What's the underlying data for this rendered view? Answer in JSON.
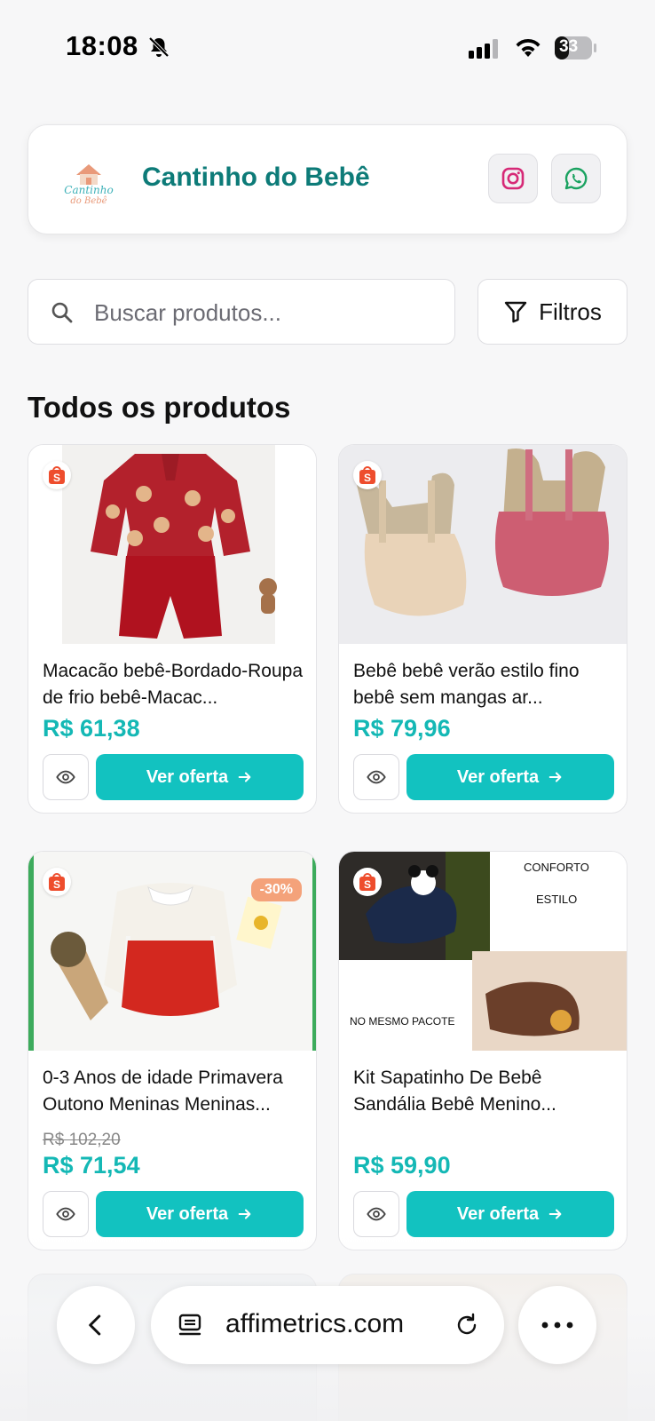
{
  "status_bar": {
    "time": "18:08",
    "battery": "33"
  },
  "header": {
    "brand_name": "Cantinho do Bebê",
    "logo_text_line1": "Cantinho",
    "logo_text_line2": "do Bebê",
    "instagram_color": "#d62976",
    "whatsapp_color": "#1aa260"
  },
  "search": {
    "placeholder": "Buscar produtos...",
    "value": ""
  },
  "filters_label": "Filtros",
  "section_title": "Todos os produtos",
  "products": [
    {
      "title": "Macacão bebê-Bordado-Roupa de frio bebê-Macac...",
      "old_price": "",
      "price": "R$ 61,38",
      "discount": "",
      "offer_label": "Ver oferta"
    },
    {
      "title": "Bebê bebê verão estilo fino bebê sem mangas ar...",
      "old_price": "",
      "price": "R$ 79,96",
      "discount": "",
      "offer_label": "Ver oferta"
    },
    {
      "title": "0-3 Anos de idade Primavera Outono Meninas Meninas...",
      "old_price": "R$ 102,20",
      "price": "R$ 71,54",
      "discount": "-30%",
      "offer_label": "Ver oferta"
    },
    {
      "title": "Kit Sapatinho De Bebê Sandália Bebê Menino...",
      "old_price": "",
      "price": "R$ 59,90",
      "discount": "",
      "offer_label": "Ver oferta",
      "image_text": {
        "top1": "CONFORTO",
        "top2": "ESTILO",
        "bottom": "NO MESMO PACOTE"
      }
    }
  ],
  "browser": {
    "url": "affimetrics.com"
  },
  "colors": {
    "accent": "#12c2c0",
    "price": "#14b8b5",
    "brand": "#0d7b78",
    "shopee": "#ee4d2d"
  }
}
